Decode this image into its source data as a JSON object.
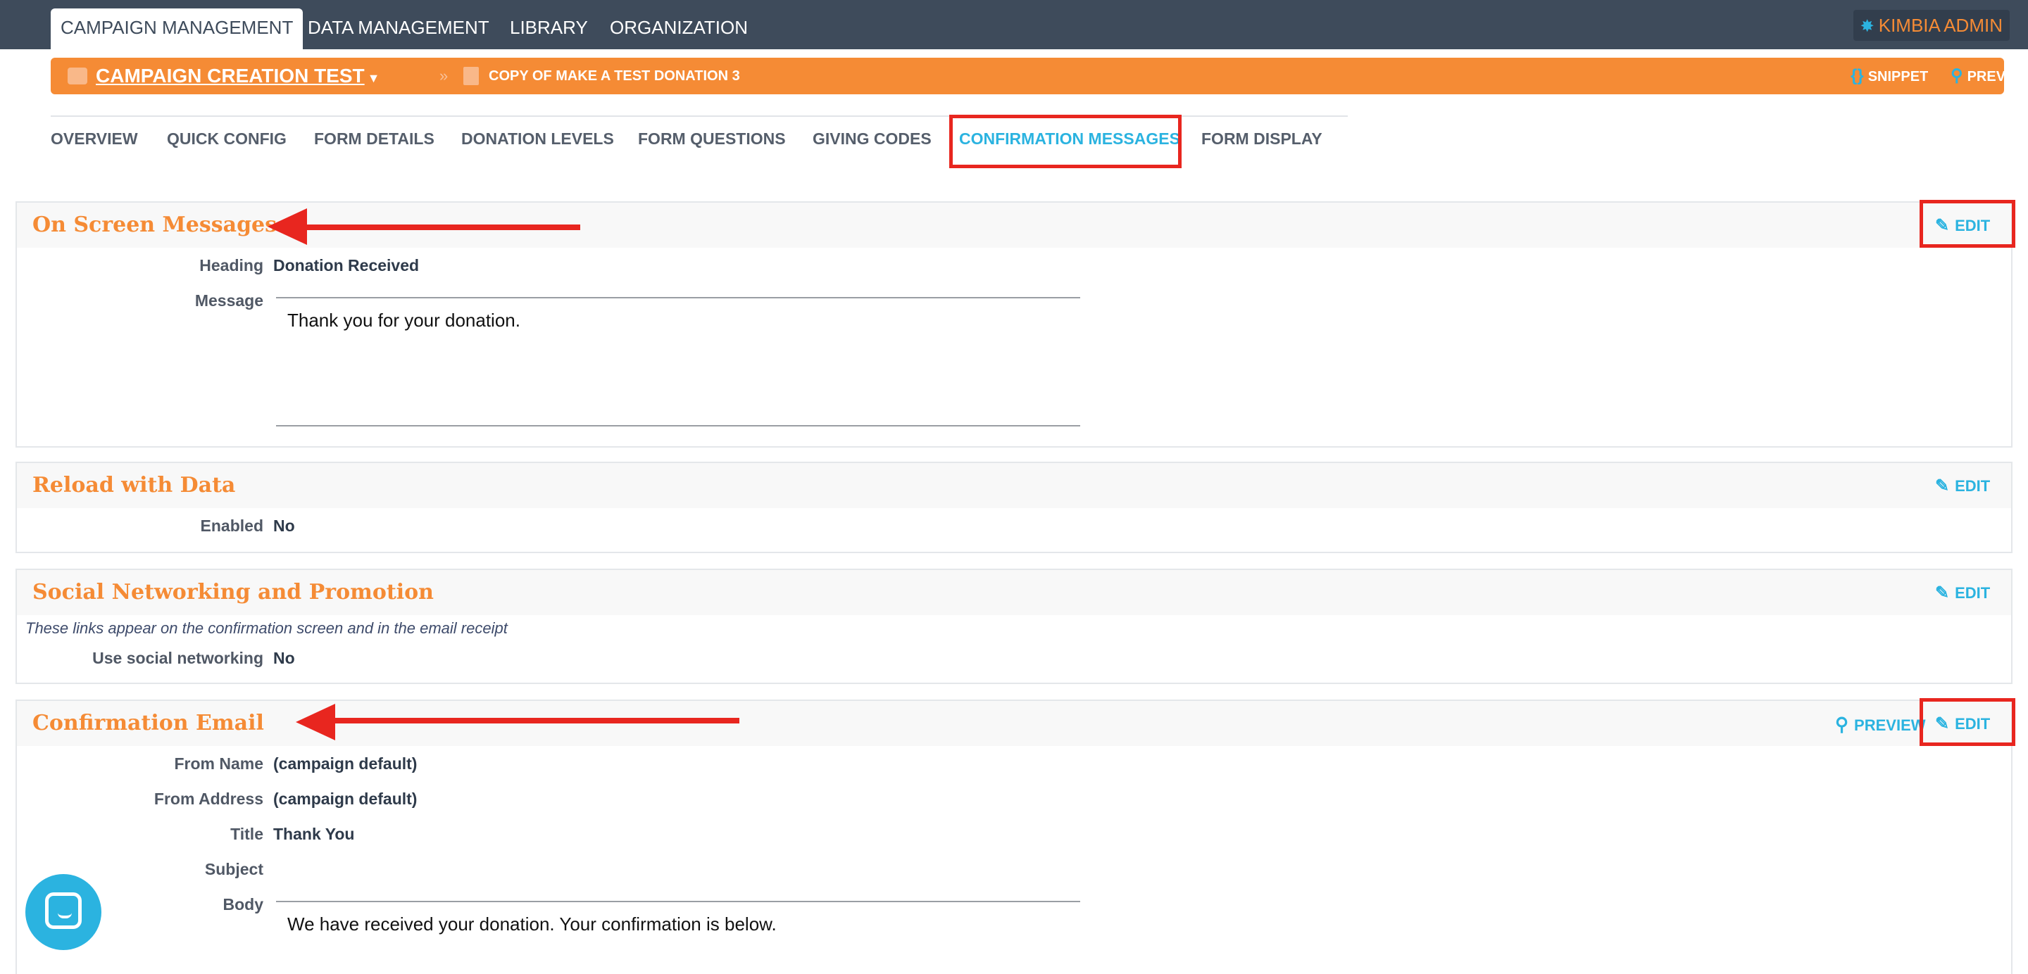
{
  "topnav": {
    "tabs": [
      {
        "label": "CAMPAIGN MANAGEMENT"
      },
      {
        "label": "DATA MANAGEMENT"
      },
      {
        "label": "LIBRARY"
      },
      {
        "label": "ORGANIZATION"
      }
    ],
    "user_label": "KIMBIA ADMIN"
  },
  "campaign_bar": {
    "campaign_name": "CAMPAIGN CREATION TEST",
    "separator": "»",
    "form_name": "COPY OF MAKE A TEST DONATION 3",
    "snippet_label": "SNIPPET",
    "preview_label": "PREVIEW"
  },
  "subtabs": [
    {
      "label": "OVERVIEW"
    },
    {
      "label": "QUICK CONFIG"
    },
    {
      "label": "FORM DETAILS"
    },
    {
      "label": "DONATION LEVELS"
    },
    {
      "label": "FORM QUESTIONS"
    },
    {
      "label": "GIVING CODES"
    },
    {
      "label": "CONFIRMATION MESSAGES"
    },
    {
      "label": "FORM DISPLAY"
    }
  ],
  "sections": {
    "on_screen": {
      "title": "On Screen Messages",
      "edit_label": "EDIT",
      "heading_label": "Heading",
      "heading_value": "Donation Received",
      "message_label": "Message",
      "message_value": "Thank you for your donation."
    },
    "reload": {
      "title": "Reload with Data",
      "edit_label": "EDIT",
      "enabled_label": "Enabled",
      "enabled_value": "No"
    },
    "social": {
      "title": "Social Networking and Promotion",
      "edit_label": "EDIT",
      "note": "These links appear on the confirmation screen and in the email receipt",
      "use_label": "Use social networking",
      "use_value": "No"
    },
    "email": {
      "title": "Confirmation Email",
      "preview_label": "PREVIEW",
      "edit_label": "EDIT",
      "from_name_label": "From Name",
      "from_name_value": "(campaign default)",
      "from_address_label": "From Address",
      "from_address_value": "(campaign default)",
      "title_label": "Title",
      "title_value": "Thank You",
      "subject_label": "Subject",
      "subject_value": "",
      "body_label": "Body",
      "body_value": "We have received your donation. Your confirmation is below."
    }
  },
  "colors": {
    "nav_bg": "#3e4b5b",
    "accent_orange": "#f58b35",
    "accent_blue": "#2bb3e0",
    "annotation_red": "#e8261f"
  },
  "icons": [
    "gear-icon",
    "briefcase-icon",
    "chevron-down-icon",
    "document-icon",
    "braces-icon",
    "search-icon",
    "pencil-icon",
    "chat-icon"
  ]
}
